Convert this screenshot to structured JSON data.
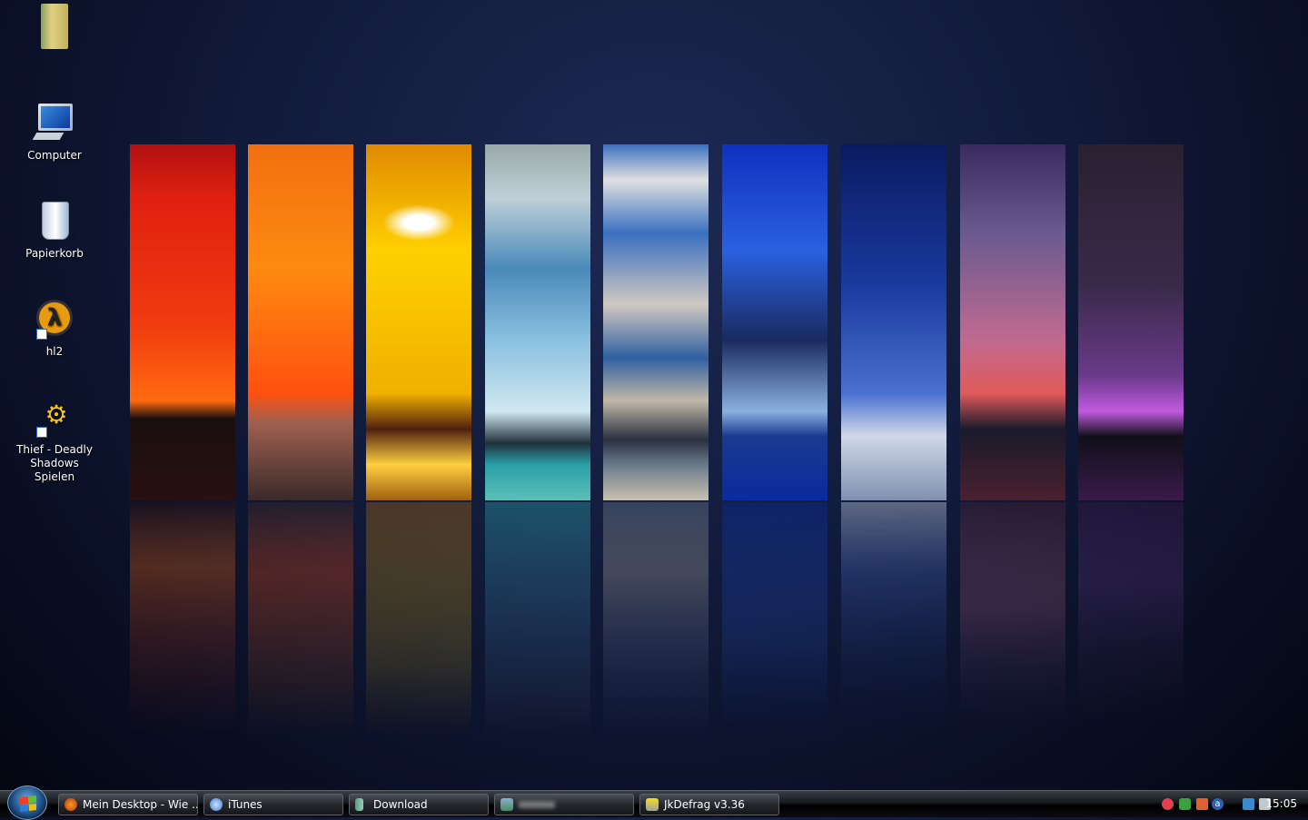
{
  "desktop": {
    "icons": [
      {
        "label": "",
        "name": "folder"
      },
      {
        "label": "Computer",
        "name": "computer"
      },
      {
        "label": "Papierkorb",
        "name": "recycle-bin"
      },
      {
        "label": "hl2",
        "name": "hl2"
      },
      {
        "label": "Thief - Deadly Shadows Spielen",
        "name": "thief"
      }
    ]
  },
  "taskbar": {
    "buttons": [
      {
        "label": "Mein Desktop - Wie ...",
        "icon": "firefox-icon"
      },
      {
        "label": "iTunes",
        "icon": "itunes-icon"
      },
      {
        "label": "Download",
        "icon": "folder-icon"
      },
      {
        "label": "",
        "icon": "window-icon"
      },
      {
        "label": "JkDefrag v3.36",
        "icon": "defrag-icon"
      }
    ],
    "clock": "15:05"
  }
}
